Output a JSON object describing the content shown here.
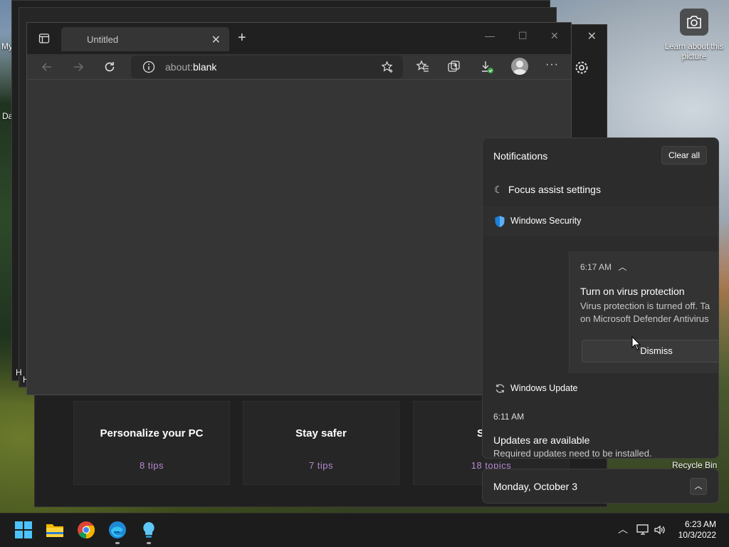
{
  "desktop": {
    "partial_labels": [
      "My",
      "Da",
      "H",
      "H"
    ],
    "camera_label": "Learn about this picture",
    "recycle_bin": "Recycle Bin"
  },
  "tips_app": {
    "cards": [
      {
        "title": "Personalize your PC",
        "subtitle": "8 tips"
      },
      {
        "title": "Stay safer",
        "subtitle": "7 tips"
      },
      {
        "title": "Show",
        "subtitle": "18 topics"
      }
    ]
  },
  "browser": {
    "tab_title": "Untitled",
    "address_prefix": "about:",
    "address_host": "blank"
  },
  "notifications": {
    "header": "Notifications",
    "clear_all": "Clear all",
    "focus_assist": "Focus assist settings",
    "groups": [
      {
        "app": "Windows Security",
        "time": "6:17 AM",
        "title": "Turn on virus protection",
        "body_line1": "Virus protection is turned off. Ta",
        "body_line2": "on Microsoft Defender Antivirus",
        "action": "Dismiss"
      },
      {
        "app": "Windows Update",
        "time": "6:11 AM",
        "title": "Updates are available",
        "body": "Required updates need to be installed."
      }
    ],
    "calendar_date": "Monday, October 3"
  },
  "taskbar": {
    "time": "6:23 AM",
    "date": "10/3/2022",
    "apps": [
      "start-icon",
      "file-explorer-icon",
      "chrome-icon",
      "edge-icon",
      "tips-icon"
    ]
  },
  "colors": {
    "accent_purple": "#b48ad0",
    "defender_blue": "#1e7fd8",
    "taskbar": "#1c1c1c"
  }
}
